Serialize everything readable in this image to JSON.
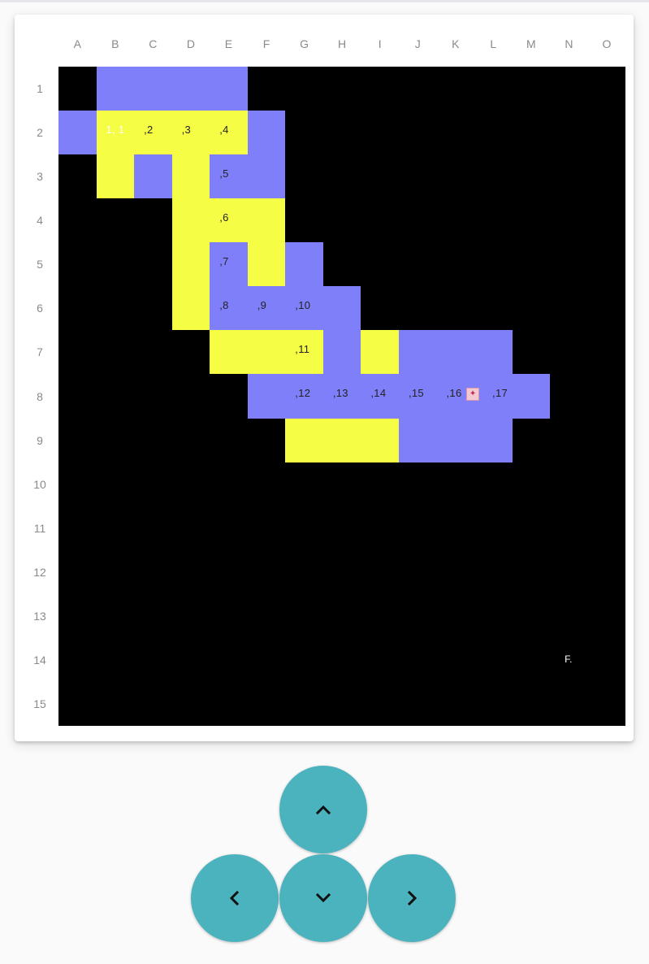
{
  "columns": [
    "A",
    "B",
    "C",
    "D",
    "E",
    "F",
    "G",
    "H",
    "I",
    "J",
    "K",
    "L",
    "M",
    "N",
    "O"
  ],
  "rows": [
    "1",
    "2",
    "3",
    "4",
    "5",
    "6",
    "7",
    "8",
    "9",
    "10",
    "11",
    "12",
    "13",
    "14",
    "15"
  ],
  "colors": {
    "wall": "#000000",
    "path": "#f5fd45",
    "open": "#7f7ff9",
    "button": "#4bb3bd"
  },
  "cells": [
    {
      "row": 1,
      "col": 2,
      "color": "open"
    },
    {
      "row": 1,
      "col": 3,
      "color": "open"
    },
    {
      "row": 1,
      "col": 4,
      "color": "open"
    },
    {
      "row": 1,
      "col": 5,
      "color": "open"
    },
    {
      "row": 2,
      "col": 1,
      "color": "open"
    },
    {
      "row": 2,
      "col": 2,
      "color": "path",
      "text": "1, 1",
      "light": true
    },
    {
      "row": 2,
      "col": 3,
      "color": "path",
      "text": ",2"
    },
    {
      "row": 2,
      "col": 4,
      "color": "path",
      "text": ",3"
    },
    {
      "row": 2,
      "col": 5,
      "color": "path",
      "text": ",4"
    },
    {
      "row": 2,
      "col": 6,
      "color": "open"
    },
    {
      "row": 3,
      "col": 2,
      "color": "path"
    },
    {
      "row": 3,
      "col": 3,
      "color": "open"
    },
    {
      "row": 3,
      "col": 4,
      "color": "path"
    },
    {
      "row": 3,
      "col": 5,
      "color": "open",
      "text": ",5"
    },
    {
      "row": 3,
      "col": 6,
      "color": "open"
    },
    {
      "row": 4,
      "col": 4,
      "color": "path"
    },
    {
      "row": 4,
      "col": 5,
      "color": "path",
      "text": ",6"
    },
    {
      "row": 4,
      "col": 6,
      "color": "path"
    },
    {
      "row": 5,
      "col": 4,
      "color": "path"
    },
    {
      "row": 5,
      "col": 5,
      "color": "open",
      "text": ",7"
    },
    {
      "row": 5,
      "col": 6,
      "color": "path"
    },
    {
      "row": 5,
      "col": 7,
      "color": "open"
    },
    {
      "row": 6,
      "col": 4,
      "color": "path"
    },
    {
      "row": 6,
      "col": 5,
      "color": "open",
      "text": ",8"
    },
    {
      "row": 6,
      "col": 6,
      "color": "open",
      "text": ",9"
    },
    {
      "row": 6,
      "col": 7,
      "color": "open",
      "text": ",10"
    },
    {
      "row": 6,
      "col": 8,
      "color": "open"
    },
    {
      "row": 7,
      "col": 5,
      "color": "path"
    },
    {
      "row": 7,
      "col": 6,
      "color": "path"
    },
    {
      "row": 7,
      "col": 7,
      "color": "path",
      "text": ",11"
    },
    {
      "row": 7,
      "col": 8,
      "color": "open"
    },
    {
      "row": 7,
      "col": 9,
      "color": "path"
    },
    {
      "row": 7,
      "col": 10,
      "color": "open"
    },
    {
      "row": 7,
      "col": 11,
      "color": "open"
    },
    {
      "row": 7,
      "col": 12,
      "color": "open"
    },
    {
      "row": 8,
      "col": 6,
      "color": "open"
    },
    {
      "row": 8,
      "col": 7,
      "color": "open",
      "text": ",12"
    },
    {
      "row": 8,
      "col": 8,
      "color": "open",
      "text": ",13"
    },
    {
      "row": 8,
      "col": 9,
      "color": "open",
      "text": ",14"
    },
    {
      "row": 8,
      "col": 10,
      "color": "open",
      "text": ",15"
    },
    {
      "row": 8,
      "col": 11,
      "color": "open",
      "text": ",16"
    },
    {
      "row": 8,
      "col": 12,
      "color": "open",
      "text": ",17",
      "token": true
    },
    {
      "row": 8,
      "col": 13,
      "color": "open"
    },
    {
      "row": 9,
      "col": 7,
      "color": "path"
    },
    {
      "row": 9,
      "col": 8,
      "color": "path"
    },
    {
      "row": 9,
      "col": 9,
      "color": "path"
    },
    {
      "row": 9,
      "col": 10,
      "color": "open"
    },
    {
      "row": 9,
      "col": 11,
      "color": "open"
    },
    {
      "row": 9,
      "col": 12,
      "color": "open"
    }
  ],
  "end_marker": {
    "row": 14,
    "col": 14,
    "text": "F."
  },
  "controls": {
    "up": "chevron-up",
    "left": "chevron-left",
    "down": "chevron-down",
    "right": "chevron-right"
  }
}
